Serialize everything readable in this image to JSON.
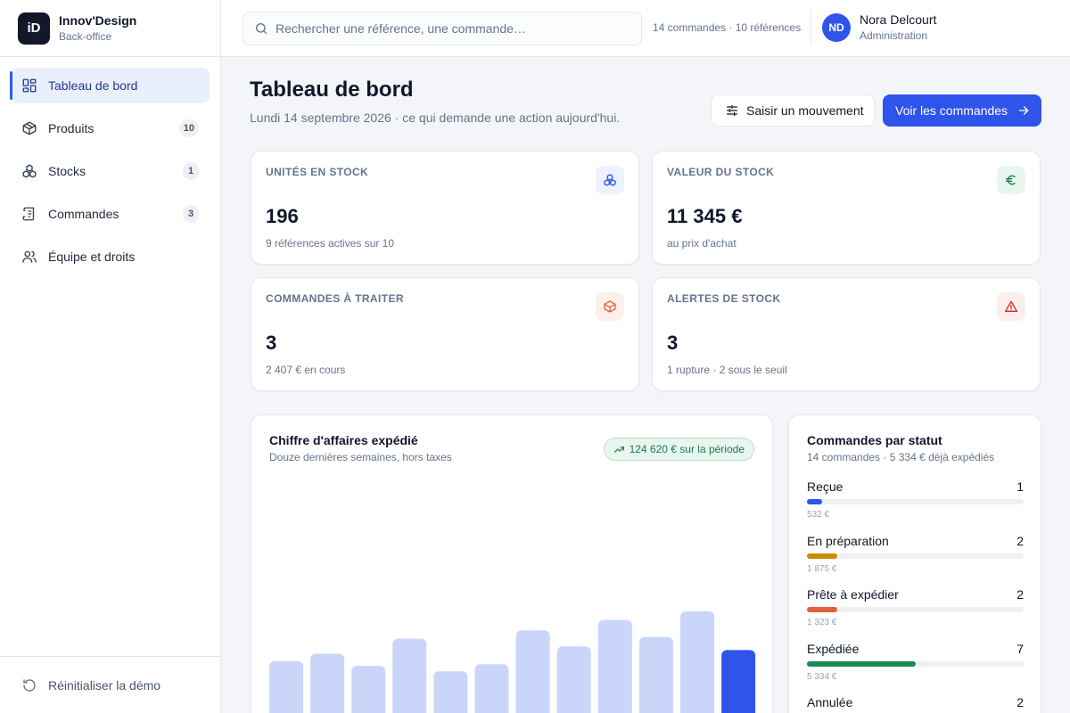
{
  "brand": {
    "logo": "iD",
    "name": "Innov'Design",
    "subtitle": "Back-office"
  },
  "sidebar": {
    "items": [
      {
        "label": "Tableau de bord",
        "icon": "grid-icon",
        "active": true
      },
      {
        "label": "Produits",
        "icon": "box-icon",
        "count": "10"
      },
      {
        "label": "Stocks",
        "icon": "boxes-icon",
        "count": "1"
      },
      {
        "label": "Commandes",
        "icon": "receipt-icon",
        "count": "3"
      },
      {
        "label": "Équipe et droits",
        "icon": "users-icon"
      }
    ],
    "reset_label": "Réinitialiser la démo"
  },
  "header": {
    "search_placeholder": "Rechercher une référence, une commande…",
    "stats": "14 commandes · 10 références",
    "user": {
      "initials": "ND",
      "name": "Nora Delcourt",
      "role": "Administration"
    }
  },
  "main": {
    "title": "Tableau de bord",
    "subtitle": "Lundi 14 septembre 2026 · ce qui demande une action aujourd'hui.",
    "actions": {
      "secondary": "Saisir un mouvement",
      "primary": "Voir les commandes"
    }
  },
  "kpis": [
    {
      "label": "UNITÉS EN STOCK",
      "value": "196",
      "note": "9 références actives sur 10",
      "icon": "boxes-icon",
      "color": "#2f54eb",
      "bg": "#eef2ff"
    },
    {
      "label": "VALEUR DU STOCK",
      "value": "11 345 €",
      "note": "au prix d'achat",
      "icon": "euro-icon",
      "color": "#15803d",
      "bg": "#e8f6ef"
    },
    {
      "label": "COMMANDES À TRAITER",
      "value": "3",
      "note": "2 407 € en cours",
      "icon": "package-icon",
      "color": "#e0623d",
      "bg": "#fdf0eb"
    },
    {
      "label": "ALERTES DE STOCK",
      "value": "3",
      "note": "1 rupture · 2 sous le seuil",
      "icon": "alert-icon",
      "color": "#dc2626",
      "bg": "#fdeeee"
    }
  ],
  "revenue": {
    "title": "Chiffre d'affaires expédié",
    "subtitle": "Douze dernières semaines, hors taxes",
    "badge": "124 620 € sur la période",
    "colors": {
      "bar": "#c9d6f9",
      "current": "#2f54eb"
    }
  },
  "chart_data": {
    "type": "bar",
    "values": [
      13000,
      14800,
      11800,
      18500,
      10500,
      12200,
      20500,
      16600,
      23100,
      18900,
      25200,
      15700
    ]
  },
  "statuses": {
    "title": "Commandes par statut",
    "subtitle": "14 commandes · 5 334 € déjà expédiés",
    "items": [
      {
        "label": "Reçue",
        "count": "1",
        "amount": "532 €",
        "share": 0.07,
        "color": "#2f54eb"
      },
      {
        "label": "En préparation",
        "count": "2",
        "amount": "1 875 €",
        "share": 0.14,
        "color": "#ca8a04"
      },
      {
        "label": "Prête à expédier",
        "count": "2",
        "amount": "1 323 €",
        "share": 0.14,
        "color": "#e0623d"
      },
      {
        "label": "Expédiée",
        "count": "7",
        "amount": "5 334 €",
        "share": 0.5,
        "color": "#178a5c"
      },
      {
        "label": "Annulée",
        "count": "2",
        "amount": "",
        "share": 0.14,
        "color": "#94a3b8"
      }
    ]
  }
}
